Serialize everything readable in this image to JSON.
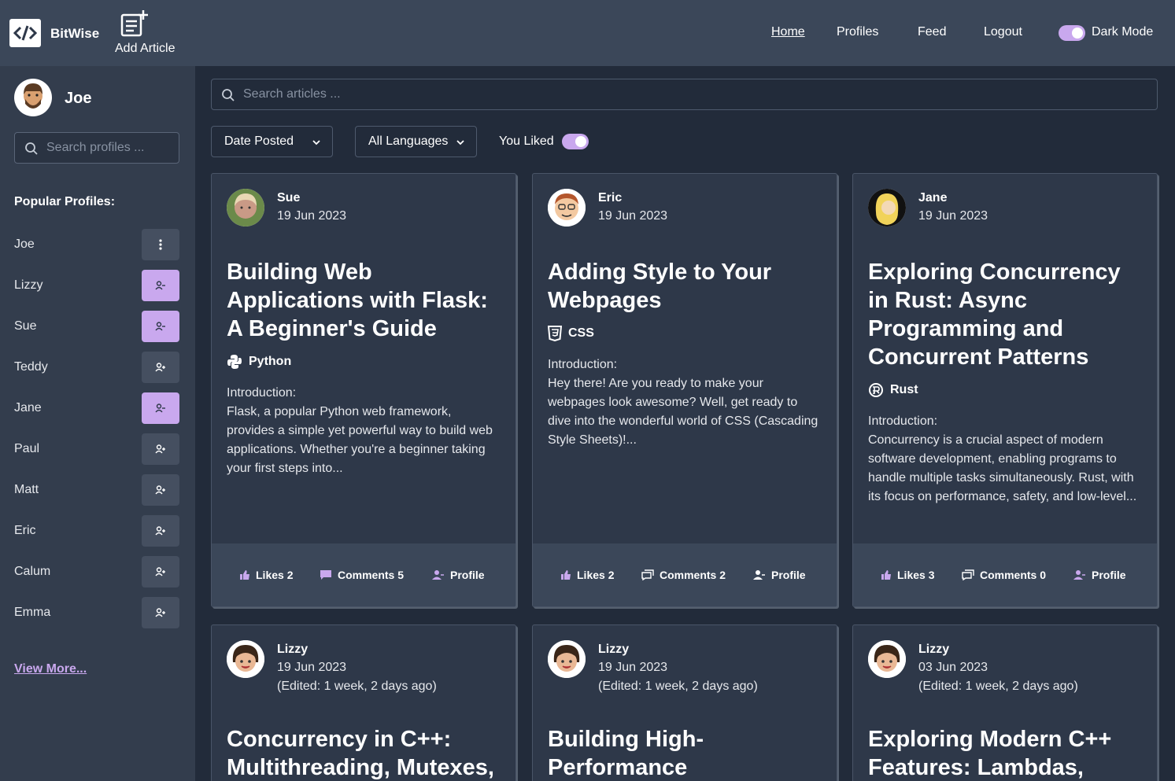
{
  "header": {
    "brand": "BitWise",
    "add_article": "Add Article",
    "nav": [
      "Home",
      "Profiles",
      "Feed",
      "Logout"
    ],
    "dark_mode_label": "Dark Mode",
    "dark_mode_on": true
  },
  "sidebar": {
    "user_name": "Joe",
    "search_placeholder": "Search profiles ...",
    "popular_title": "Popular Profiles:",
    "profiles": [
      {
        "name": "Joe",
        "action": "menu"
      },
      {
        "name": "Lizzy",
        "action": "unfollow"
      },
      {
        "name": "Sue",
        "action": "unfollow"
      },
      {
        "name": "Teddy",
        "action": "follow"
      },
      {
        "name": "Jane",
        "action": "unfollow"
      },
      {
        "name": "Paul",
        "action": "follow"
      },
      {
        "name": "Matt",
        "action": "follow"
      },
      {
        "name": "Eric",
        "action": "follow"
      },
      {
        "name": "Calum",
        "action": "follow"
      },
      {
        "name": "Emma",
        "action": "follow"
      }
    ],
    "view_more": "View More..."
  },
  "main": {
    "search_placeholder": "Search articles ...",
    "sort_label": "Date Posted",
    "language_label": "All Languages",
    "you_liked_label": "You Liked",
    "you_liked_on": true
  },
  "colors": {
    "accent": "#c9a8ee",
    "card": "#2e3849",
    "header": "#3b4759",
    "background": "#222b3a"
  },
  "articles": [
    {
      "author": "Sue",
      "date": "19 Jun 2023",
      "title": "Building Web Applications with Flask: A Beginner's Guide",
      "language": "Python",
      "language_icon": "python-icon",
      "intro_heading": "Introduction:",
      "intro": "Flask, a popular Python web framework, provides a simple yet powerful way to build web applications. Whether you're a beginner taking your first steps into...",
      "likes": "Likes 2",
      "comments": "Comments 5",
      "profile": "Profile"
    },
    {
      "author": "Eric",
      "date": "19 Jun 2023",
      "title": "Adding Style to Your Webpages",
      "language": "CSS",
      "language_icon": "css-icon",
      "intro_heading": "Introduction:",
      "intro": "Hey there! Are you ready to make your webpages look awesome? Well, get ready to dive into the wonderful world of CSS (Cascading Style Sheets)!...",
      "likes": "Likes 2",
      "comments": "Comments 2",
      "profile": "Profile"
    },
    {
      "author": "Jane",
      "date": "19 Jun 2023",
      "title": "Exploring Concurrency in Rust: Async Programming and Concurrent Patterns",
      "language": "Rust",
      "language_icon": "rust-icon",
      "intro_heading": "Introduction:",
      "intro": "Concurrency is a crucial aspect of modern software development, enabling programs to handle multiple tasks simultaneously. Rust, with its focus on performance, safety, and low-level...",
      "likes": "Likes 3",
      "comments": "Comments 0",
      "profile": "Profile"
    },
    {
      "author": "Lizzy",
      "date": "19 Jun 2023",
      "edited": "(Edited: 1 week, 2 days ago)",
      "title": "Concurrency in C++: Multithreading, Mutexes,"
    },
    {
      "author": "Lizzy",
      "date": "19 Jun 2023",
      "edited": "(Edited: 1 week, 2 days ago)",
      "title": "Building High-Performance"
    },
    {
      "author": "Lizzy",
      "date": "03 Jun 2023",
      "edited": "(Edited: 1 week, 2 days ago)",
      "title": "Exploring Modern C++ Features: Lambdas,"
    }
  ]
}
